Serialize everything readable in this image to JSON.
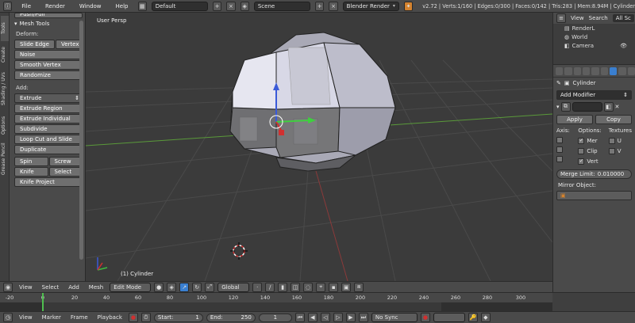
{
  "top": {
    "menus": [
      "File",
      "Render",
      "Window",
      "Help"
    ],
    "layout": "Default",
    "scene": "Scene",
    "engine": "Blender Render",
    "stats": "v2.72 | Verts:1/160 | Edges:0/300 | Faces:0/142 | Tris:283 | Mem:8.94M | Cylinder"
  },
  "toolshelf": {
    "tabs": [
      "Tools",
      "Create",
      "Shading / UVs",
      "Options",
      "Grease Pencil"
    ],
    "top_cut_label": "Push/Pull",
    "panel_title": "Mesh Tools",
    "deform_label": "Deform:",
    "slide_edge": "Slide Edge",
    "vertex": "Vertex",
    "noise": "Noise",
    "smooth_vertex": "Smooth Vertex",
    "randomize": "Randomize",
    "add_label": "Add:",
    "extrude": "Extrude",
    "extrude_region": "Extrude Region",
    "extrude_individual": "Extrude Individual",
    "subdivide": "Subdivide",
    "loop_cut": "Loop Cut and Slide",
    "duplicate": "Duplicate",
    "spin": "Spin",
    "screw": "Screw",
    "knife": "Knife",
    "select": "Select",
    "knife_project": "Knife Project"
  },
  "viewport": {
    "view_name": "User Persp",
    "object_label": "(1) Cylinder"
  },
  "outliner": {
    "view": "View",
    "search": "Search",
    "all_scenes": "All Sc",
    "items": [
      "RenderL",
      "World",
      "Camera"
    ]
  },
  "properties": {
    "object_name": "Cylinder",
    "add_modifier": "Add Modifier",
    "apply": "Apply",
    "copy": "Copy",
    "axis": "Axis:",
    "options": "Options:",
    "textures": "Textures",
    "mer": "Mer",
    "clip": "Clip",
    "vert": "Vert",
    "u": "U",
    "v": "V",
    "merge_limit": "Merge Limit:",
    "merge_value": "0.010000",
    "mirror_object": "Mirror Object:"
  },
  "vp_header": {
    "view": "View",
    "select": "Select",
    "add": "Add",
    "mesh": "Mesh",
    "mode": "Edit Mode",
    "orientation": "Global"
  },
  "timeline": {
    "ticks": [
      "-20",
      "0",
      "20",
      "40",
      "60",
      "80",
      "100",
      "120",
      "140",
      "160",
      "180",
      "200",
      "220",
      "240",
      "260",
      "280",
      "300"
    ]
  },
  "bottom": {
    "view": "View",
    "marker": "Marker",
    "frame": "Frame",
    "playback": "Playback",
    "start_label": "Start:",
    "start_val": "1",
    "end_label": "End:",
    "end_val": "250",
    "current_val": "1",
    "sync": "No Sync"
  },
  "colors": {
    "grid_x_axis": "#b04848",
    "grid_y_axis": "#5a9a3a",
    "mesh_face": "#b9b9c2",
    "accent_blue": "#3a7fd0"
  }
}
